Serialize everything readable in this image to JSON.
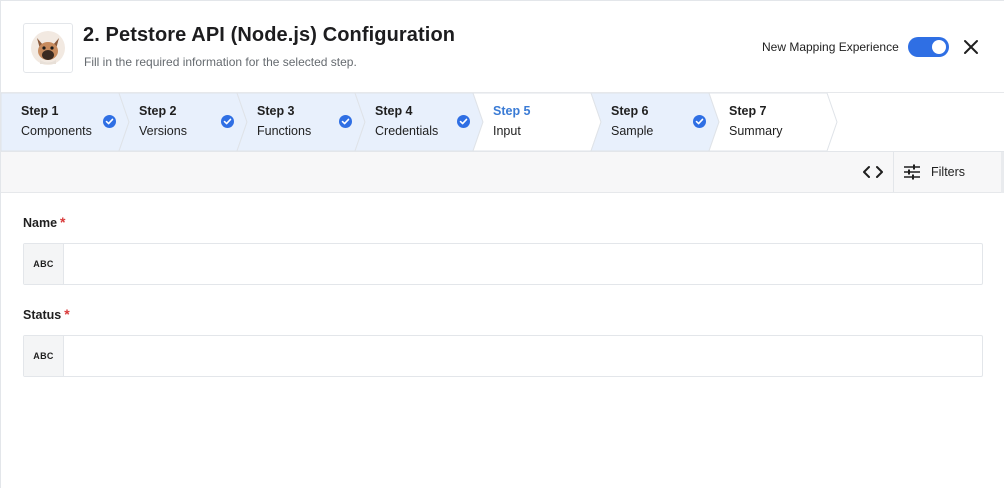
{
  "header": {
    "title": "2. Petstore API (Node.js) Configuration",
    "subtitle": "Fill in the required information for the selected step.",
    "logo_icon": "dog-avatar-icon",
    "toggle_label": "New Mapping Experience",
    "toggle_on": true,
    "close_icon": "close-icon"
  },
  "steps": [
    {
      "num": "Step 1",
      "label": "Components",
      "completed": true,
      "active": false
    },
    {
      "num": "Step 2",
      "label": "Versions",
      "completed": true,
      "active": false
    },
    {
      "num": "Step 3",
      "label": "Functions",
      "completed": true,
      "active": false
    },
    {
      "num": "Step 4",
      "label": "Credentials",
      "completed": true,
      "active": false
    },
    {
      "num": "Step 5",
      "label": "Input",
      "completed": false,
      "active": true
    },
    {
      "num": "Step 6",
      "label": "Sample",
      "completed": true,
      "active": false
    },
    {
      "num": "Step 7",
      "label": "Summary",
      "completed": false,
      "active": false
    }
  ],
  "toolbar": {
    "code_icon": "code-icon",
    "filters_icon": "sliders-icon",
    "filters_label": "Filters"
  },
  "form": {
    "fields": [
      {
        "label": "Name",
        "required_mark": "*",
        "type_badge": "ABC",
        "value": ""
      },
      {
        "label": "Status",
        "required_mark": "*",
        "type_badge": "ABC",
        "value": ""
      }
    ]
  },
  "colors": {
    "accent": "#2f6fe4",
    "active_step_text": "#3a7bd5",
    "completed_step_bg": "#e8f0fc",
    "required": "#d93a3a"
  }
}
